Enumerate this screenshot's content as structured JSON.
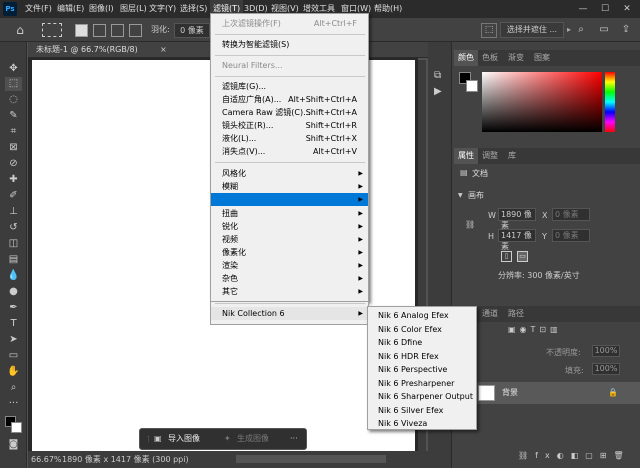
{
  "menubar": {
    "logo": "Ps",
    "items": [
      "文件(F)",
      "编辑(E)",
      "图像(I)",
      "图层(L)",
      "文字(Y)",
      "选择(S)",
      "滤镜(T)",
      "3D(D)",
      "视图(V)",
      "增效工具",
      "窗口(W)",
      "帮助(H)"
    ]
  },
  "options": {
    "feather_label": "羽化:",
    "feather_value": "0 像素",
    "select_mask": "选择并遮住 ..."
  },
  "document": {
    "tab_title": "未标题-1 @ 66.7%(RGB/8)",
    "zoom": "66.67%",
    "info": "1890 像素 x 1417 像素 (300 ppi)"
  },
  "context_bar": {
    "import_image": "导入图像",
    "generate_image": "生成图像",
    "more": "···"
  },
  "filter_menu": {
    "last_filter": "上次滤镜操作(F)",
    "last_filter_shortcut": "Alt+Ctrl+F",
    "convert_smart": "转换为智能滤镜(S)",
    "neural": "Neural Filters...",
    "gallery": "滤镜库(G)...",
    "adaptive_wide": "自适应广角(A)...",
    "adaptive_wide_shortcut": "Alt+Shift+Ctrl+A",
    "camera_raw": "Camera Raw 滤镜(C)...",
    "camera_raw_shortcut": "Shift+Ctrl+A",
    "lens_correction": "镜头校正(R)...",
    "lens_correction_shortcut": "Shift+Ctrl+R",
    "liquify": "液化(L)...",
    "liquify_shortcut": "Shift+Ctrl+X",
    "vanishing_point": "消失点(V)...",
    "vanishing_point_shortcut": "Alt+Ctrl+V",
    "stylize": "风格化",
    "blur": "模糊",
    "distort": "扭曲",
    "sharpen": "锐化",
    "video": "视频",
    "pixelate": "像素化",
    "render": "渲染",
    "noise": "杂色",
    "other": "其它",
    "nik": "Nik Collection 6"
  },
  "nik_submenu": [
    "Nik 6 Analog Efex",
    "Nik 6 Color Efex",
    "Nik 6 Dfine",
    "Nik 6 HDR Efex",
    "Nik 6 Perspective",
    "Nik 6 Presharpener",
    "Nik 6 Sharpener Output",
    "Nik 6 Silver Efex",
    "Nik 6 Viveza"
  ],
  "color_panel": {
    "tabs": [
      "颜色",
      "色板",
      "渐变",
      "图案"
    ]
  },
  "properties_panel": {
    "tabs": [
      "属性",
      "调整",
      "库"
    ],
    "doc_label": "文档",
    "canvas_label": "画布",
    "w_label": "W",
    "w_value": "1890 像素",
    "h_label": "H",
    "h_value": "1417 像素",
    "x_label": "X",
    "y_label": "Y",
    "x_placeholder": "0 像素",
    "y_placeholder": "0 像素",
    "resolution": "分辨率: 300 像素/英寸"
  },
  "layers_panel": {
    "tabs": [
      "通道",
      "路径"
    ],
    "opacity_label": "不透明度:",
    "opacity_value": "100%",
    "fill_label": "填充:",
    "fill_value": "100%",
    "layer_name": "背景"
  },
  "colors": {
    "accent": "#0078d7",
    "bg": "#535353",
    "panel": "#424242"
  }
}
